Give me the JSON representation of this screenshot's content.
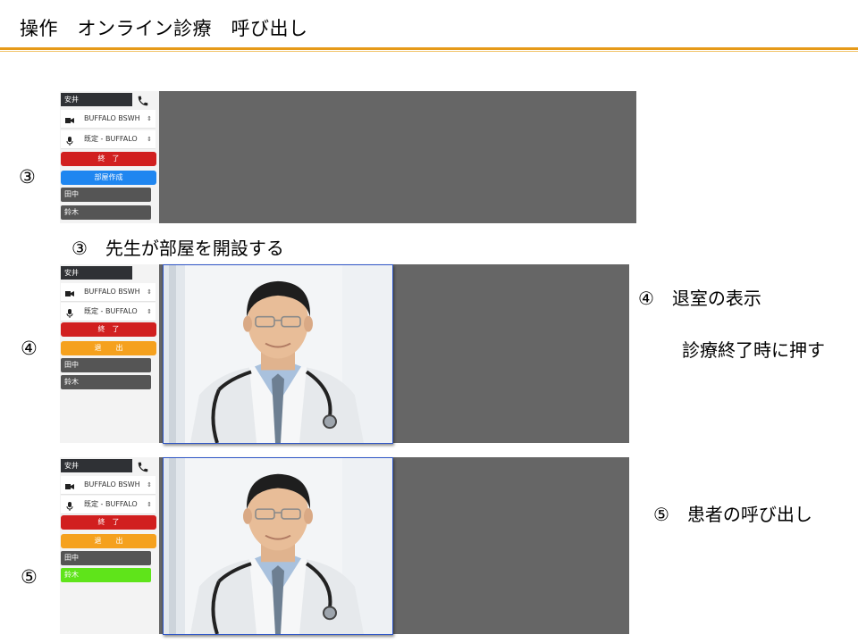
{
  "slide": {
    "title": "操作　オンライン診療　呼び出し"
  },
  "panels": [
    {
      "step_marker": "③",
      "sidebar": {
        "user_name": "安井",
        "call_icon": "phone-icon",
        "camera_device": "BUFFALO BSWH",
        "mic_device": "既定 - BUFFALO",
        "end_label": "終　了",
        "action_label": "部屋作成",
        "action_color": "#1f86f0",
        "users": [
          "田中",
          "鈴木"
        ]
      },
      "caption": "③　先生が部屋を開設する"
    },
    {
      "step_marker": "④",
      "sidebar": {
        "user_name": "安井",
        "camera_device": "BUFFALO BSWH",
        "mic_device": "既定 - BUFFALO",
        "end_label": "終　了",
        "action_label": "退　　出",
        "action_color": "#f5a11e",
        "users": [
          "田中",
          "鈴木"
        ]
      },
      "caption_title": "④　退室の表示",
      "caption_note": "診療終了時に押す"
    },
    {
      "step_marker": "⑤",
      "sidebar": {
        "user_name": "安井",
        "call_icon": "phone-icon",
        "camera_device": "BUFFALO BSWH",
        "mic_device": "既定 - BUFFALO",
        "end_label": "終　了",
        "action_label": "退　　出",
        "action_color": "#f5a11e",
        "users": [
          "田中",
          "鈴木"
        ],
        "highlighted_user_color": "#5fe41a"
      },
      "caption": "⑤　患者の呼び出し"
    }
  ],
  "icons": {
    "camera": "video-camera-icon",
    "mic": "microphone-icon",
    "select": "updown-arrows-icon"
  },
  "colors": {
    "title_rule": "#e69a18",
    "end_button": "#d11f1f",
    "video_background": "#666666"
  }
}
